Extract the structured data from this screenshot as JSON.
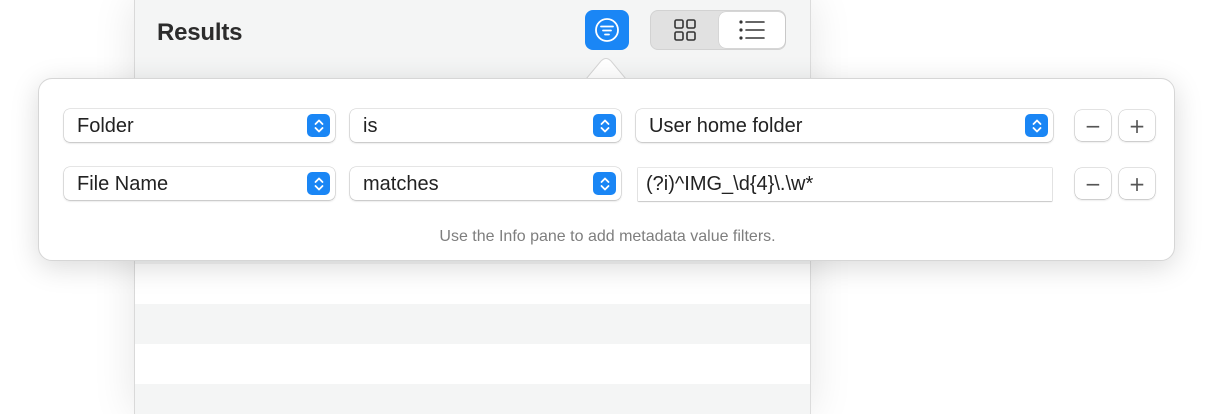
{
  "header": {
    "title": "Results"
  },
  "toolbar": {
    "filter_icon": "filter-icon",
    "view_modes": [
      {
        "name": "grid",
        "icon": "grid-icon",
        "selected": false
      },
      {
        "name": "list",
        "icon": "list-icon",
        "selected": true
      }
    ]
  },
  "filters": {
    "rows": [
      {
        "field": "Folder",
        "operator": "is",
        "value": "User home folder",
        "value_type": "popup"
      },
      {
        "field": "File Name",
        "operator": "matches",
        "value": "(?i)^IMG_\\d{4}\\.\\w*",
        "value_type": "text"
      }
    ],
    "remove_label": "−",
    "add_label": "+",
    "hint": "Use the Info pane to add metadata value filters."
  },
  "colors": {
    "accent": "#1a86f5",
    "row_alt": "#f4f5f5",
    "hint_text": "#7e7e7e"
  }
}
